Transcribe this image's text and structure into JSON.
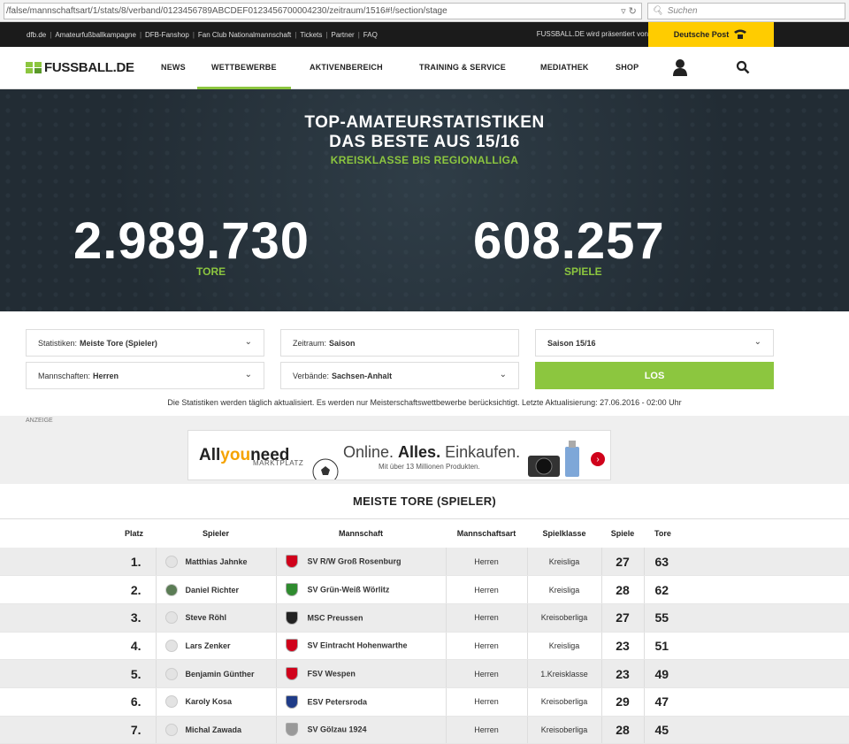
{
  "browser": {
    "url": "/false/mannschaftsart/1/stats/8/verband/0123456789ABCDEF0123456700004230/zeitraum/1516#!/section/stage",
    "search_placeholder": "Suchen"
  },
  "topbar": {
    "links": [
      "dfb.de",
      "Amateurfußballkampagne",
      "DFB-Fanshop",
      "Fan Club Nationalmannschaft",
      "Tickets",
      "Partner",
      "FAQ"
    ],
    "presented": "FUSSBALL.DE wird präsentiert von",
    "sponsor": "Deutsche Post"
  },
  "nav": {
    "logo": "FUSSBALL.DE",
    "items": [
      "NEWS",
      "WETTBEWERBE",
      "AKTIVENBEREICH",
      "TRAINING & SERVICE",
      "MEDIATHEK",
      "SHOP"
    ]
  },
  "hero": {
    "title1": "TOP-AMATEURSTATISTIKEN",
    "title2": "DAS BESTE AUS 15/16",
    "subtitle": "KREISKLASSE BIS REGIONALLIGA",
    "goals_value": "2.989.730",
    "goals_label": "TORE",
    "games_value": "608.257",
    "games_label": "SPIELE"
  },
  "filters": {
    "statistiken_label": "Statistiken:",
    "statistiken_value": "Meiste Tore (Spieler)",
    "zeitraum_label": "Zeitraum:",
    "zeitraum_value": "Saison",
    "saison_value": "Saison 15/16",
    "mannschaften_label": "Mannschaften:",
    "mannschaften_value": "Herren",
    "verbaende_label": "Verbände:",
    "verbaende_value": "Sachsen-Anhalt",
    "submit": "LOS",
    "note": "Die Statistiken werden täglich aktualisiert. Es werden nur Meisterschaftswettbewerbe berücksichtigt. Letzte Aktualisierung: 27.06.2016 - 02:00 Uhr"
  },
  "ad": {
    "label": "ANZEIGE",
    "brand_a": "All",
    "brand_b": "you",
    "brand_c": "need",
    "marktplatz": "MARKTPLATZ",
    "headline_a": "Online. ",
    "headline_b": "Alles.",
    "headline_c": " Einkaufen.",
    "small": "Mit über 13 Millionen Produkten."
  },
  "table": {
    "title": "MEISTE TORE (SPIELER)",
    "headers": [
      "Platz",
      "Spieler",
      "Mannschaft",
      "Mannschaftsart",
      "Spielklasse",
      "Spiele",
      "Tore"
    ],
    "rows": [
      {
        "platz": "1.",
        "spieler": "Matthias Jahnke",
        "team": "SV R/W Groß Rosenburg",
        "art": "Herren",
        "klasse": "Kreisliga",
        "spiele": "27",
        "tore": "63",
        "crest": "#d0021b"
      },
      {
        "platz": "2.",
        "spieler": "Daniel Richter",
        "team": "SV Grün-Weiß Wörlitz",
        "art": "Herren",
        "klasse": "Kreisliga",
        "spiele": "28",
        "tore": "62",
        "crest": "#2e8b2e"
      },
      {
        "platz": "3.",
        "spieler": "Steve Röhl",
        "team": "MSC Preussen",
        "art": "Herren",
        "klasse": "Kreisoberliga",
        "spiele": "27",
        "tore": "55",
        "crest": "#222222"
      },
      {
        "platz": "4.",
        "spieler": "Lars Zenker",
        "team": "SV Eintracht Hohenwarthe",
        "art": "Herren",
        "klasse": "Kreisliga",
        "spiele": "23",
        "tore": "51",
        "crest": "#d0021b"
      },
      {
        "platz": "5.",
        "spieler": "Benjamin Günther",
        "team": "FSV Wespen",
        "art": "Herren",
        "klasse": "1.Kreisklasse",
        "spiele": "23",
        "tore": "49",
        "crest": "#d0021b"
      },
      {
        "platz": "6.",
        "spieler": "Karoly Kosa",
        "team": "ESV Petersroda",
        "art": "Herren",
        "klasse": "Kreisoberliga",
        "spiele": "29",
        "tore": "47",
        "crest": "#1f3c88"
      },
      {
        "platz": "7.",
        "spieler": "Michal Zawada",
        "team": "SV Gölzau 1924",
        "art": "Herren",
        "klasse": "Kreisoberliga",
        "spiele": "28",
        "tore": "45",
        "crest": "#999999"
      }
    ]
  }
}
